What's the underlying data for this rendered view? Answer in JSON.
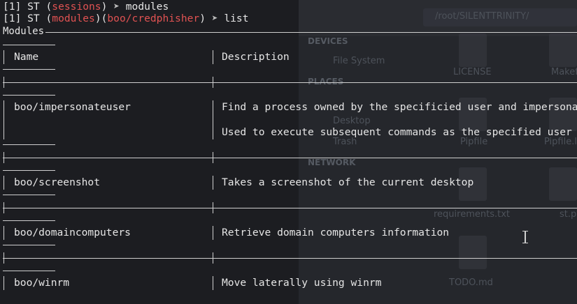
{
  "terminal": {
    "line1": {
      "prefix": "[1] ST (",
      "ctx": "sessions",
      "suffix": ") ",
      "arrow": "➤",
      "cmd": " modules"
    },
    "line2": {
      "prefix": "[1] ST (",
      "ctx1": "modules",
      "mid": ")(",
      "ctx2": "boo/credphisher",
      "suffix": ") ",
      "arrow": "➤",
      "cmd": " list"
    }
  },
  "table": {
    "title": "Modules",
    "headers": {
      "name": "Name",
      "description": "Description"
    },
    "rows": [
      {
        "name": "boo/impersonateuser",
        "description": [
          "Find a process owned by the specificied user and impersonate",
          "Used to execute subsequent commands as the specified user"
        ]
      },
      {
        "name": "boo/screenshot",
        "description": [
          "Takes a screenshot of the current desktop"
        ]
      },
      {
        "name": "boo/domaincomputers",
        "description": [
          "Retrieve domain computers information"
        ]
      },
      {
        "name": "boo/winrm",
        "description": [
          "Move laterally using winrm"
        ]
      }
    ]
  },
  "background": {
    "path": "/root/SILENTTRINITY/",
    "sidebar": {
      "devices": "DEVICES",
      "file_system": "File System",
      "places": "PLACES",
      "desktop": "Desktop",
      "trash": "Trash",
      "network": "NETWORK"
    },
    "files": [
      "LICENSE",
      "Makefile",
      "Pipfile",
      "Pipfile.lock",
      "requirements.txt",
      "st.py",
      "TODO.md"
    ]
  },
  "colors": {
    "background": "#1c1d21",
    "text": "#e6e6e6",
    "accent_red": "#e05252",
    "border": "#cfcfcf"
  }
}
